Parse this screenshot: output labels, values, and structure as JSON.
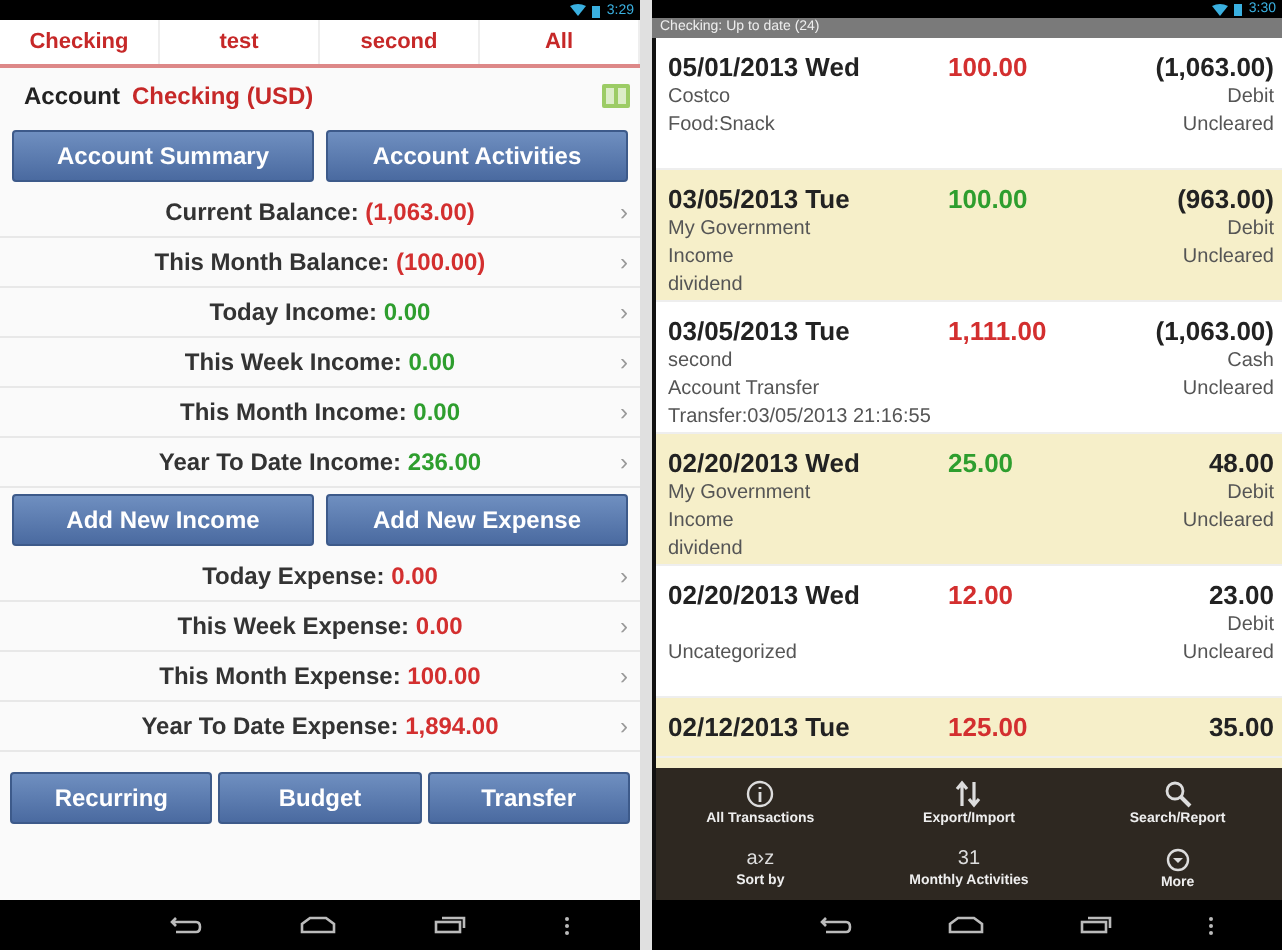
{
  "left_screen": {
    "status_bar": {
      "time": "3:29"
    },
    "tabs": [
      {
        "label": "Checking"
      },
      {
        "label": "test"
      },
      {
        "label": "second"
      },
      {
        "label": "All"
      }
    ],
    "account": {
      "label": "Account",
      "name": "Checking (USD)"
    },
    "top_buttons": [
      "Account Summary",
      "Account Activities"
    ],
    "income_rows": [
      {
        "label": "Current Balance:",
        "value": "(1,063.00)",
        "kind": "expense",
        "chevron": "›"
      },
      {
        "label": "This Month Balance:",
        "value": "(100.00)",
        "kind": "expense",
        "chevron": "›"
      },
      {
        "label": "Today Income:",
        "value": "0.00",
        "kind": "income",
        "chevron": "›"
      },
      {
        "label": "This Week Income:",
        "value": "0.00",
        "kind": "income",
        "chevron": "›"
      },
      {
        "label": "This Month Income:",
        "value": "0.00",
        "kind": "income",
        "chevron": "›"
      },
      {
        "label": "Year To Date Income:",
        "value": "236.00",
        "kind": "income",
        "chevron": "›"
      }
    ],
    "middle_buttons": [
      "Add New Income",
      "Add New Expense"
    ],
    "expense_rows": [
      {
        "label": "Today Expense:",
        "value": "0.00",
        "kind": "expense",
        "chevron": "›"
      },
      {
        "label": "This Week Expense:",
        "value": "0.00",
        "kind": "expense",
        "chevron": "›"
      },
      {
        "label": "This Month Expense:",
        "value": "100.00",
        "kind": "expense",
        "chevron": "›"
      },
      {
        "label": "Year To Date Expense:",
        "value": "1,894.00",
        "kind": "expense",
        "chevron": "›"
      }
    ],
    "bottom_buttons": [
      "Recurring",
      "Budget",
      "Transfer"
    ]
  },
  "right_screen": {
    "status_bar": {
      "time": "3:30"
    },
    "header": "Checking: Up to date (24)",
    "transactions": [
      {
        "date": "05/01/2013 Wed",
        "amount": "100.00",
        "kind": "expense",
        "balance": "(1,063.00)",
        "details": [
          "Costco",
          "Food:Snack"
        ],
        "meta": [
          "Debit",
          "Uncleared"
        ],
        "highlighted": false
      },
      {
        "date": "03/05/2013 Tue",
        "amount": "100.00",
        "kind": "income",
        "balance": "(963.00)",
        "details": [
          "My Government",
          "Income",
          "dividend"
        ],
        "meta": [
          "Debit",
          "Uncleared"
        ],
        "highlighted": true
      },
      {
        "date": "03/05/2013 Tue",
        "amount": "1,111.00",
        "kind": "expense",
        "balance": "(1,063.00)",
        "details": [
          "second",
          "Account Transfer",
          "Transfer:03/05/2013 21:16:55"
        ],
        "meta": [
          "Cash",
          "Uncleared"
        ],
        "highlighted": false
      },
      {
        "date": "02/20/2013 Wed",
        "amount": "25.00",
        "kind": "income",
        "balance": "48.00",
        "details": [
          "My Government",
          "Income",
          "dividend"
        ],
        "meta": [
          "Debit",
          "Uncleared"
        ],
        "highlighted": true
      },
      {
        "date": "02/20/2013 Wed",
        "amount": "12.00",
        "kind": "expense",
        "balance": "23.00",
        "details": [
          "Uncategorized"
        ],
        "meta": [
          "Debit",
          "Uncleared"
        ],
        "highlighted": false
      },
      {
        "date": "02/12/2013 Tue",
        "amount": "125.00",
        "kind": "expense",
        "balance": "35.00",
        "highlighted": true
      }
    ],
    "menu": [
      {
        "label": "All Transactions"
      },
      {
        "label": "Export/Import"
      },
      {
        "label": "Search/Report"
      },
      {
        "label": "Sort by",
        "glyph": "a›z"
      },
      {
        "label": "Monthly Activities",
        "glyph": "31"
      },
      {
        "label": "More"
      }
    ]
  }
}
